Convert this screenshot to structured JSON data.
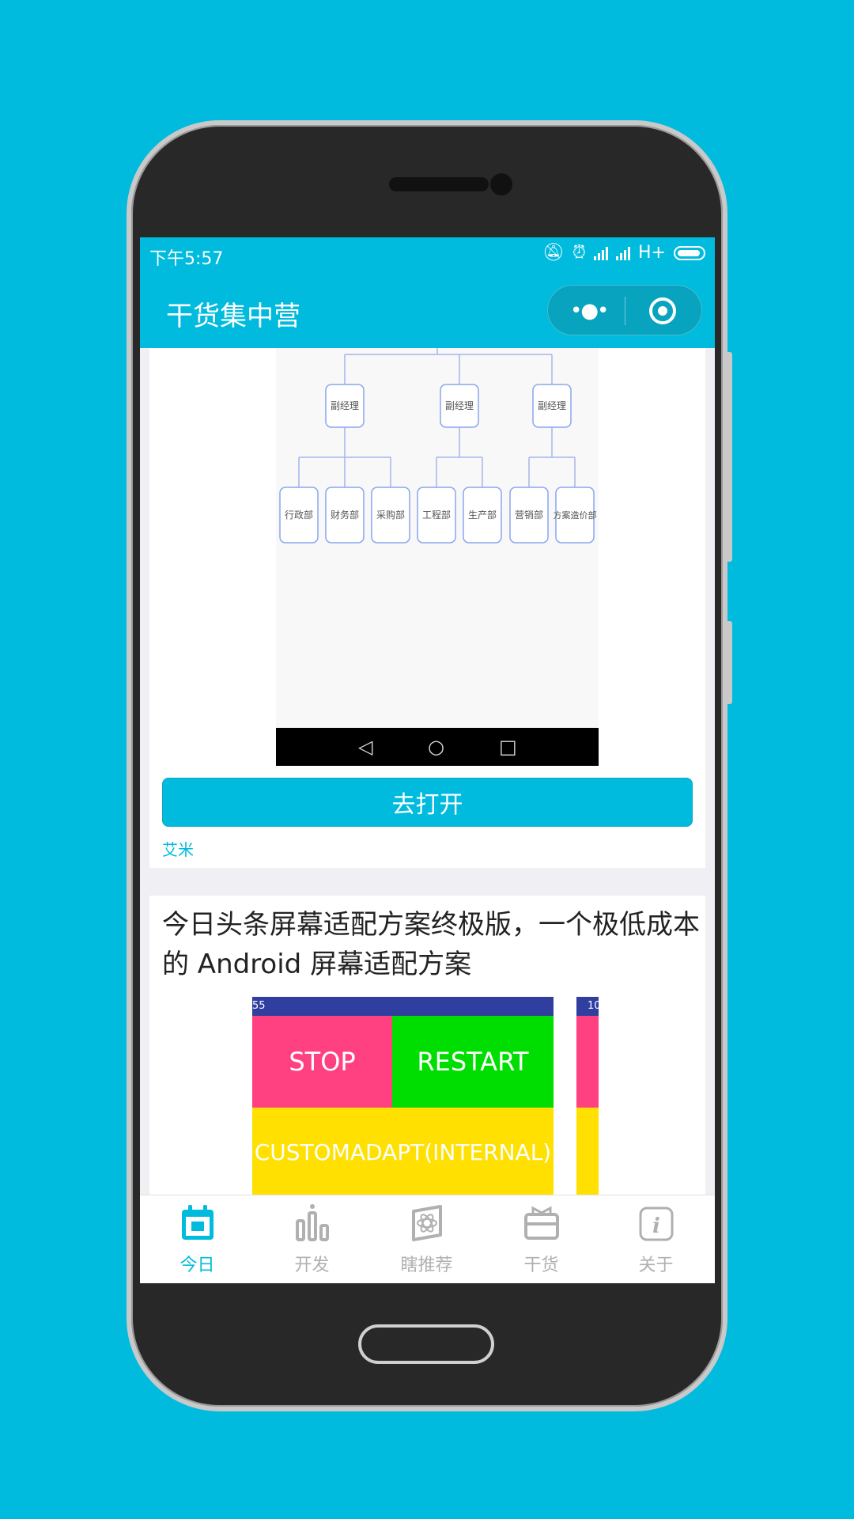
{
  "status_bar": {
    "time": "下午5:57",
    "network": "H+"
  },
  "nav": {
    "title": "干货集中营"
  },
  "card1": {
    "org_boxes": {
      "managers": [
        "副经理",
        "副经理",
        "副经理"
      ],
      "departments": [
        "行政部",
        "财务部",
        "采购部",
        "工程部",
        "生产部",
        "营销部",
        "方案造价部"
      ]
    },
    "open_button": "去打开",
    "author": "艾米"
  },
  "card2": {
    "title": "今日头条屏幕适配方案终极版，一个极低成本的 Android 屏幕适配方案",
    "preview": {
      "status_left": "55",
      "status_left_b": "10",
      "stop": "STOP",
      "restart": "RESTART",
      "custom": "CUSTOMADAPT(INTERNAL)"
    }
  },
  "tabs": [
    {
      "label": "今日",
      "icon": "calendar-icon",
      "active": true
    },
    {
      "label": "开发",
      "icon": "bar-chart-icon",
      "active": false
    },
    {
      "label": "瞎推荐",
      "icon": "atom-icon",
      "active": false
    },
    {
      "label": "干货",
      "icon": "gift-box-icon",
      "active": false
    },
    {
      "label": "关于",
      "icon": "info-icon",
      "active": false
    }
  ],
  "colors": {
    "primary": "#00BBDD",
    "pink": "#FF4081",
    "green": "#00DD00",
    "yellow": "#FFE000",
    "indigo": "#303F9F"
  }
}
